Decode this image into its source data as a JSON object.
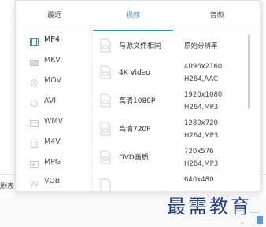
{
  "tabs": [
    {
      "label": "最近"
    },
    {
      "label": "视频"
    },
    {
      "label": "音频"
    }
  ],
  "active_tab": "视频",
  "formats": [
    {
      "label": "MP4",
      "icon": "film-icon",
      "active": true
    },
    {
      "label": "MKV",
      "icon": "folder-icon"
    },
    {
      "label": "MOV",
      "icon": "mov-icon"
    },
    {
      "label": "AVI",
      "icon": "avi-icon"
    },
    {
      "label": "WMV",
      "icon": "wmv-icon"
    },
    {
      "label": "M4V",
      "icon": "m4v-icon"
    },
    {
      "label": "MPG",
      "icon": "mpg-icon"
    },
    {
      "label": "VOB",
      "icon": "vob-icon"
    }
  ],
  "presets": [
    {
      "name": "与源文件相同",
      "res1": "原始分辨率",
      "res2": ""
    },
    {
      "name": "4K Video",
      "res1": "4096x2160",
      "res2": "H264,AAC"
    },
    {
      "name": "高清1080P",
      "res1": "1920x1080",
      "res2": "H264,MP3"
    },
    {
      "name": "高清720P",
      "res1": "1280x720",
      "res2": "H264,MP3"
    },
    {
      "name": "DVD画质",
      "res1": "720x576",
      "res2": "H264,MP3"
    },
    {
      "name": "",
      "res1": "640x480",
      "res2": ""
    }
  ],
  "background": {
    "field_label": "剧表"
  },
  "watermark": {
    "text": "最需教育"
  },
  "colors": {
    "accent": "#2a8fd8",
    "watermark": "#1f3b8c"
  }
}
